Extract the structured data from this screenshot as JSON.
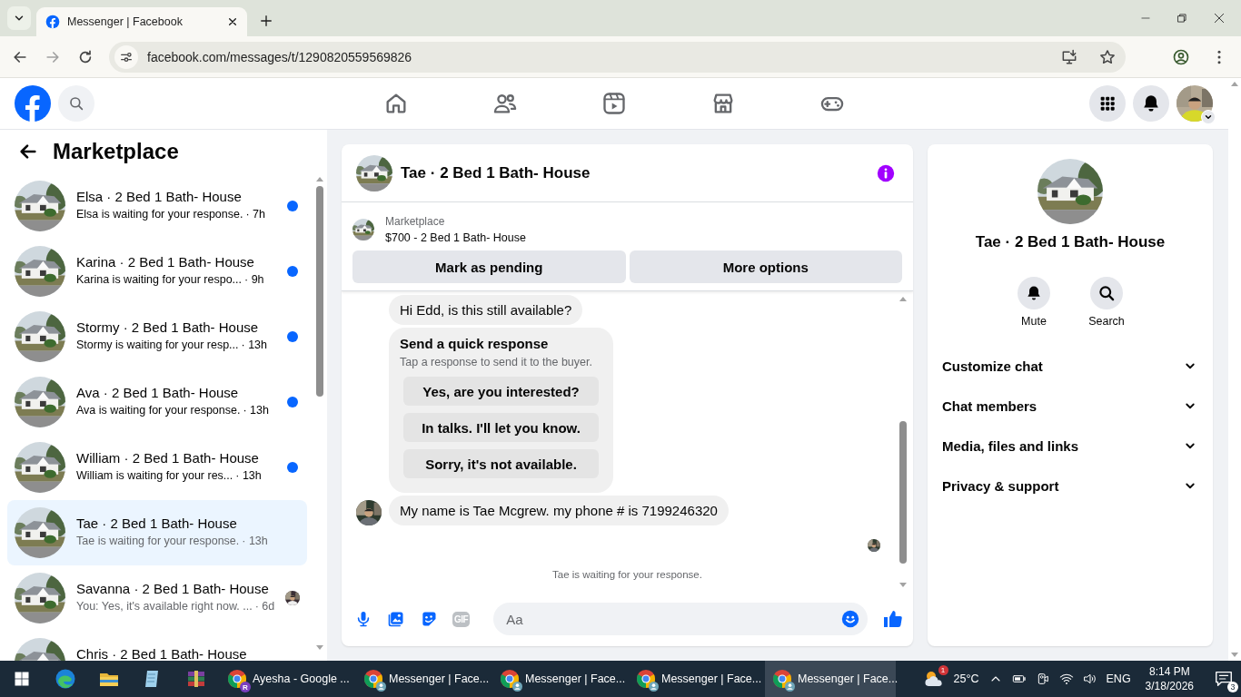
{
  "browser": {
    "tabs": [
      {
        "title": "Messenger | Facebook",
        "selected": true
      }
    ],
    "url": "facebook.com/messages/t/1290820559569826"
  },
  "sidebar": {
    "title": "Marketplace",
    "conversations": [
      {
        "title": "Elsa · 2 Bed 1 Bath- House",
        "preview": "Elsa is waiting for your response.",
        "time": "· 7h",
        "unread": true,
        "seen": false,
        "selected": false
      },
      {
        "title": "Karina · 2 Bed 1 Bath- House",
        "preview": "Karina is waiting for your respo...",
        "time": "· 9h",
        "unread": true,
        "seen": false,
        "selected": false
      },
      {
        "title": "Stormy · 2 Bed 1 Bath- House",
        "preview": "Stormy is waiting for your resp...",
        "time": "· 13h",
        "unread": true,
        "seen": false,
        "selected": false
      },
      {
        "title": "Ava · 2 Bed 1 Bath- House",
        "preview": "Ava is waiting for your response.",
        "time": "· 13h",
        "unread": true,
        "seen": false,
        "selected": false
      },
      {
        "title": "William · 2 Bed 1 Bath- House",
        "preview": "William is waiting for your res...",
        "time": "· 13h",
        "unread": true,
        "seen": false,
        "selected": false
      },
      {
        "title": "Tae · 2 Bed 1 Bath- House",
        "preview": "Tae is waiting for your response.",
        "time": "· 13h",
        "unread": false,
        "seen": false,
        "selected": true
      },
      {
        "title": "Savanna · 2 Bed 1 Bath- House",
        "preview": "You: Yes, it's available right now. ...",
        "time": "· 6d",
        "unread": false,
        "seen": true,
        "selected": false
      },
      {
        "title": "Chris · 2 Bed 1 Bath- House",
        "selected": false
      }
    ]
  },
  "chat": {
    "title": "Tae · 2 Bed 1 Bath- House",
    "listing": {
      "label": "Marketplace",
      "title": "$700 - 2 Bed 1 Bath- House"
    },
    "actions": [
      "Mark as pending",
      "More options"
    ],
    "messages": [
      {
        "kind": "text",
        "text": "Hi Edd, is this still available?",
        "show_avatar": false
      },
      {
        "kind": "quick_response",
        "title": "Send a quick response",
        "subtitle": "Tap a response to send it to the buyer.",
        "options": [
          "Yes, are you interested?",
          "In talks. I'll let you know.",
          "Sorry, it's not available."
        ]
      },
      {
        "kind": "text",
        "text": "My name is Tae Mcgrew. my phone # is 7199246320",
        "show_avatar": true
      }
    ],
    "seen": true,
    "status": "Tae is waiting for your response.",
    "composer": {
      "placeholder": "Aa",
      "gif_label": "GIF"
    }
  },
  "info": {
    "title": "Tae · 2 Bed 1 Bath- House",
    "actions": [
      {
        "kind": "mute",
        "label": "Mute"
      },
      {
        "kind": "search",
        "label": "Search"
      }
    ],
    "sections": [
      {
        "label": "Customize chat",
        "expanded": false
      },
      {
        "label": "Chat members",
        "expanded": false
      },
      {
        "label": "Media, files and links",
        "expanded": false
      },
      {
        "label": "Privacy & support",
        "expanded": false
      }
    ]
  },
  "taskbar": {
    "apps": [
      {
        "label": "Ayesha - Google ...",
        "badge": "R",
        "active": false
      },
      {
        "label": "Messenger | Face...",
        "active": false
      },
      {
        "label": "Messenger | Face...",
        "active": false
      },
      {
        "label": "Messenger | Face...",
        "active": false
      },
      {
        "label": "Messenger | Face...",
        "active": true
      }
    ],
    "weather_badge": "1",
    "temperature": "25°C",
    "language": "ENG",
    "time": "8:14 PM",
    "date": "3/18/2026",
    "notification_count": "3"
  }
}
